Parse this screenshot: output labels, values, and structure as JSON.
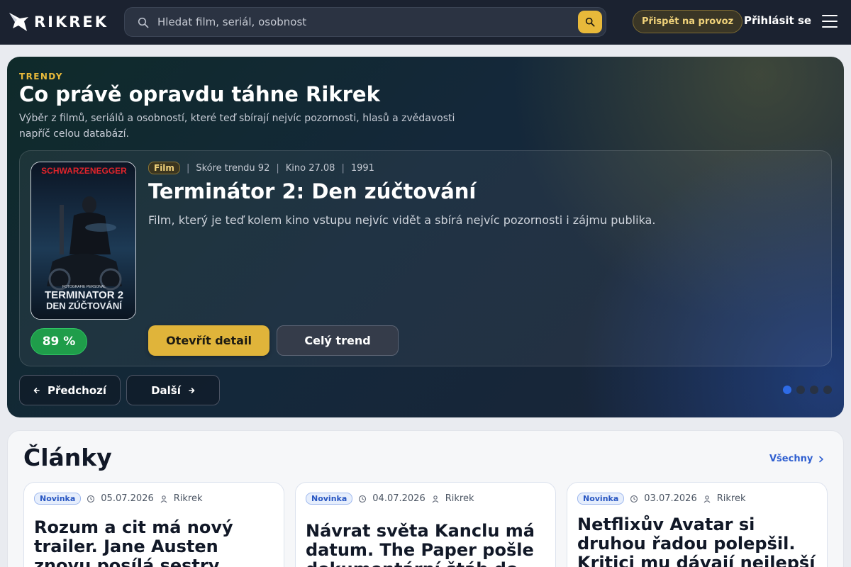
{
  "brand": {
    "name": "RIKREK"
  },
  "search": {
    "placeholder": "Hledat film, seriál, osobnost"
  },
  "header": {
    "donate_label": "Přispět na provoz",
    "login_label": "Přihlásit se"
  },
  "trending": {
    "kicker": "TRENDY",
    "title": "Co právě opravdu táhne Rikrek",
    "description": "Výběr z filmů, seriálů a osobností, které teď sbírají nejvíc pozornosti, hlasů a zvědavosti napříč celou databází.",
    "item": {
      "type": "Film",
      "trend_score": "Skóre trendu 92",
      "cinema": "Kino 27.08",
      "year": "1991",
      "title": "Terminátor 2: Den zúčtování",
      "description": "Film, který je teď kolem kino vstupu nejvíc vidět a sbírá nejvíc pozornosti i zájmu publika.",
      "rating": "89 %",
      "poster": {
        "top_text": "SCHWARZENEGGER",
        "presenter": "FOTOGRAFIE PERSONAL",
        "line1": "TERMINATOR 2",
        "line2": "DEN ZÚČTOVÁNÍ"
      },
      "detail_label": "Otevřít detail",
      "trend_label": "Celý trend"
    },
    "prev_label": "Předchozí",
    "next_label": "Další",
    "slides_total": 4,
    "active_slide": 1
  },
  "articles": {
    "title": "Články",
    "all_label": "Všechny",
    "items": [
      {
        "badge": "Novinka",
        "date": "05.07.2026",
        "author": "Rikrek",
        "title": "Rozum a cit má nový trailer. Jane Austen znovu posílá sestry"
      },
      {
        "badge": "Novinka",
        "date": "04.07.2026",
        "author": "Rikrek",
        "title": "Návrat světa Kanclu má datum. The Paper pošle dokumentární štáb do"
      },
      {
        "badge": "Novinka",
        "date": "03.07.2026",
        "author": "Rikrek",
        "title": "Netflixův Avatar si druhou řadou polepšil. Kritici mu dávají nejlepší čísla od"
      }
    ]
  },
  "colors": {
    "accent": "#e0b43a",
    "rating_green": "#1f9d4a",
    "link_blue": "#2f5fd0",
    "active_dot": "#2e6be6"
  }
}
